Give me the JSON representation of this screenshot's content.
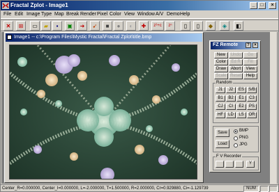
{
  "app": {
    "title": "Fractal Zplot - Image1"
  },
  "menu": [
    "File",
    "Edit",
    "Image",
    "Type",
    "Map",
    "Break",
    "Render",
    "Pixel",
    "Color",
    "View",
    "Window",
    "A/V",
    "Demo",
    "Help"
  ],
  "toolbar": {
    "icons": [
      "fractal-logo-icon",
      "zoom-icon",
      "new-icon",
      "open-icon",
      "save-icon",
      "image-icon",
      "redo-arrow-icon",
      "pointer-icon",
      "square-icon",
      "sphere-icon",
      "shell-icon",
      "pin-icon",
      "formula-z2c-icon",
      "formula-zn-icon",
      "page-icon",
      "page-icon",
      "diamond-icon",
      "mask-icon",
      "cube-icon"
    ],
    "formula_z2c": "z²+c",
    "formula_zn": "zⁿ"
  },
  "child": {
    "title": "Image1 -- c:\\Program Files\\Mystic Fractal\\Fractal Zplot\\title.bmp"
  },
  "remote": {
    "title": "FZ Remote",
    "row1": [
      "New",
      "Undo",
      "Go"
    ],
    "row2": [
      "Color",
      "Ed R",
      "Fill"
    ],
    "row3": [
      "Draw",
      "Abort",
      "View"
    ],
    "row4": [
      "Scale",
      "Reset",
      "Help"
    ],
    "random_label": "Random",
    "random_buttons": [
      [
        "J1",
        "J2",
        "ES",
        "S/B"
      ],
      [
        "B1",
        "B2",
        "E1",
        "C3"
      ],
      [
        "CJ",
        "CI",
        "E2",
        "PS"
      ],
      [
        "HF",
        "LD",
        "LS",
        "OR"
      ]
    ],
    "save_label": "Save",
    "load_label": "Load",
    "formats": [
      "BMP",
      "PNG",
      "JPG"
    ],
    "selected_format": "BMP",
    "recorder_label": "F V Recorder",
    "recorder_buttons": [
      "",
      "",
      "",
      "Y"
    ]
  },
  "status": {
    "text": "Center_R=0.000000, Center_I=0.000000, L=-2.000000, T=1.500000, R=2.000000, Cr=0.929880, Ci=-1.129739",
    "num": "NUM"
  }
}
